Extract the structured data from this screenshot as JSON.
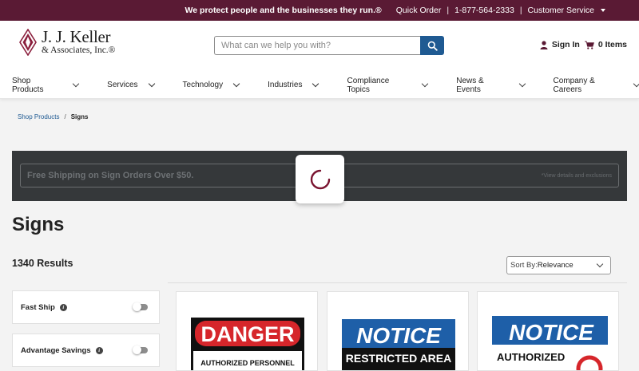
{
  "topbar": {
    "tagline": "We protect people and the businesses they run.®",
    "quick_order": "Quick Order",
    "phone": "1-877-564-2333",
    "customer_service": "Customer Service"
  },
  "logo": {
    "line1": "J. J. Keller",
    "line2": "& Associates, Inc.®"
  },
  "search": {
    "placeholder": "What can we help you with?"
  },
  "account": {
    "sign_in": "Sign In",
    "cart": "0 Items"
  },
  "nav": {
    "items": [
      {
        "label": "Shop Products"
      },
      {
        "label": "Services"
      },
      {
        "label": "Technology"
      },
      {
        "label": "Industries"
      },
      {
        "label": "Compliance Topics"
      },
      {
        "label": "News & Events"
      },
      {
        "label": "Company & Careers"
      }
    ]
  },
  "breadcrumb": {
    "parent": "Shop Products",
    "current": "Signs"
  },
  "banner": {
    "message": "Free Shipping on Sign Orders Over $50.",
    "details": "*View details and exclusions"
  },
  "page": {
    "title": "Signs",
    "results": "1340 Results"
  },
  "sort": {
    "label": "Sort By:",
    "value": "Relevance"
  },
  "filters": [
    {
      "label": "Fast Ship",
      "enabled": false
    },
    {
      "label": "Advantage Savings",
      "enabled": false
    }
  ],
  "products": [
    {
      "header": "DANGER",
      "subtext": "AUTHORIZED PERSONNEL",
      "header_color": "#d6262b",
      "style": "danger"
    },
    {
      "header": "NOTICE",
      "subtext": "RESTRICTED AREA",
      "header_color": "#1e5fa8",
      "style": "notice"
    },
    {
      "header": "NOTICE",
      "subtext": "AUTHORIZED",
      "header_color": "#1e5fa8",
      "style": "notice-icon"
    }
  ],
  "colors": {
    "brand": "#5a1a34",
    "search_button": "#1f5a92",
    "banner_bg": "#35383a",
    "link": "#1f5a92"
  }
}
